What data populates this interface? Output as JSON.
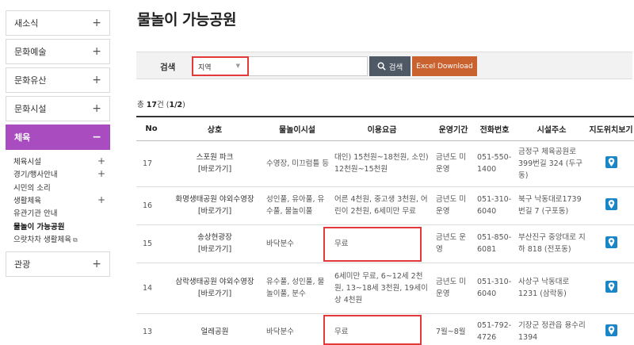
{
  "sidebar": {
    "items_top": [
      {
        "label": "새소식",
        "toggle": "+"
      },
      {
        "label": "문화예술",
        "toggle": "+"
      },
      {
        "label": "문화유산",
        "toggle": "+"
      },
      {
        "label": "문화시설",
        "toggle": "+"
      }
    ],
    "active": {
      "label": "체육",
      "toggle": "−"
    },
    "sub_items": [
      {
        "label": "체육시설",
        "toggle": "+"
      },
      {
        "label": "경기/행사안내",
        "toggle": "+"
      },
      {
        "label": "시민의 소리",
        "toggle": ""
      },
      {
        "label": "생활체육",
        "toggle": "+"
      },
      {
        "label": "유관기관 안내",
        "toggle": ""
      },
      {
        "label": "물놀이 가능공원",
        "toggle": ""
      },
      {
        "label": "으랏차차 생활체육",
        "toggle": ""
      }
    ],
    "external_mark": "⧉",
    "after": {
      "label": "관광",
      "toggle": "+"
    }
  },
  "page_title": "물놀이 가능공원",
  "search": {
    "label": "검색",
    "select_value": "지역",
    "input_value": "",
    "search_button": "검색",
    "excel_button": "Excel Download"
  },
  "count": {
    "prefix": "총 ",
    "total": "17",
    "suffix1": "건 (",
    "page": "1/2",
    "suffix2": ")"
  },
  "table": {
    "headers": [
      "No",
      "상호",
      "물놀이시설",
      "이용요금",
      "운영기간",
      "전화번호",
      "시설주소",
      "지도위치보기"
    ],
    "rows": [
      {
        "no": "17",
        "name": "스포원 파크",
        "link": "[바로가기]",
        "facility": "수영장, 미끄럼틀 등",
        "fee": "대인) 15천원~18천원, 소인) 12천원~15천원",
        "period": "금년도 미운영",
        "phone": "051-550-1400",
        "address": "금정구 체육공원로 399번길 324 (두구동)"
      },
      {
        "no": "16",
        "name": "화명생태공원 야외수영장",
        "link": "[바로가기]",
        "facility": "성인풀, 유아풀, 유수풀, 물놀이풀",
        "fee": "어른 4천원, 중고생 3천원, 어린이 2천원, 6세미만 무료",
        "period": "금년도 미운영",
        "phone": "051-310-6040",
        "address": "북구 낙동대로1739번길 7 (구포동)"
      },
      {
        "no": "15",
        "name": "송상현광장",
        "link": "[바로가기]",
        "facility": "바닥분수",
        "fee": "무료",
        "period": "금년도 운영",
        "phone": "051-850-6081",
        "address": "부산진구 중앙대로 지하 818 (전포동)"
      },
      {
        "no": "14",
        "name": "삼락생태공원 야외수영장",
        "link": "[바로가기]",
        "facility": "유수풀, 성인풀, 물놀이풀, 분수",
        "fee": "6세미만 무료, 6~12세 2천원, 13~18세 3천원, 19세이상 4천원",
        "period": "금년도 미운영",
        "phone": "051-310-6040",
        "address": "사상구 낙동대로 1231 (삼락동)"
      },
      {
        "no": "13",
        "name": "얼레공원",
        "link": "",
        "facility": "바닥분수",
        "fee": "무료",
        "period": "7월~8월",
        "phone": "051-792-4726",
        "address": "기장군 정관읍 용수리 1394"
      }
    ]
  },
  "colors": {
    "accent": "#a84cbf",
    "highlight": "#e23a3a",
    "search_btn": "#4f5966",
    "excel_btn": "#c9622f",
    "map_icon": "#1a85c7"
  }
}
